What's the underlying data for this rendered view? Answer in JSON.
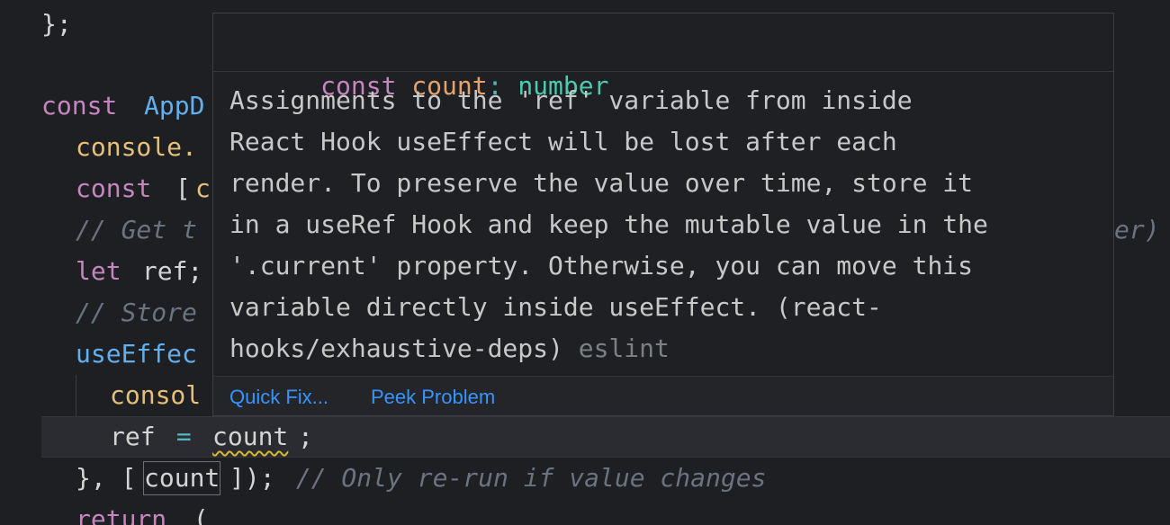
{
  "editor": {
    "lines": {
      "l0": {
        "punc": "};"
      },
      "l1": {
        "kw": "const",
        "name": "AppD"
      },
      "l2": {
        "obj": "console."
      },
      "l3": {
        "kw": "const",
        "punc": " [",
        "name": "c"
      },
      "l4": {
        "comment": "// Get t",
        "comment_tail": "er)"
      },
      "l5": {
        "kw": "let",
        "var": " ref;"
      },
      "l6": {
        "comment": "// Store"
      },
      "l7": {
        "fn": "useEffec"
      },
      "l8": {
        "obj": "consol"
      },
      "l9": {
        "var": "ref",
        "op": " = ",
        "token": "count",
        "punc": ";"
      },
      "l10": {
        "punc_open": "}, [",
        "token": "count",
        "punc_close": "]);",
        "comment": " // Only re-run if value changes"
      },
      "l11": {
        "kw": "return",
        "punc": " ("
      }
    }
  },
  "hover": {
    "signature": {
      "keyword": "const",
      "name": "count",
      "colon": ":",
      "type": "number"
    },
    "message": "Assignments to the 'ref' variable from inside\nReact Hook useEffect will be lost after each\nrender. To preserve the value over time, store it\nin a useRef Hook and keep the mutable value in the\n'.current' property. Otherwise, you can move this\nvariable directly inside useEffect. (react-\nhooks/exhaustive-deps) ",
    "source": "eslint",
    "actions": {
      "quick_fix": "Quick Fix...",
      "peek_problem": "Peek Problem"
    }
  },
  "colors": {
    "background": "#1e1f22",
    "keyword": "#c586c0",
    "function": "#61afef",
    "object": "#e5c07b",
    "operator": "#56b6c2",
    "comment": "#6b7280",
    "type": "#4ec9b0",
    "link": "#3794ff",
    "squiggle": "#d7ba2d"
  }
}
